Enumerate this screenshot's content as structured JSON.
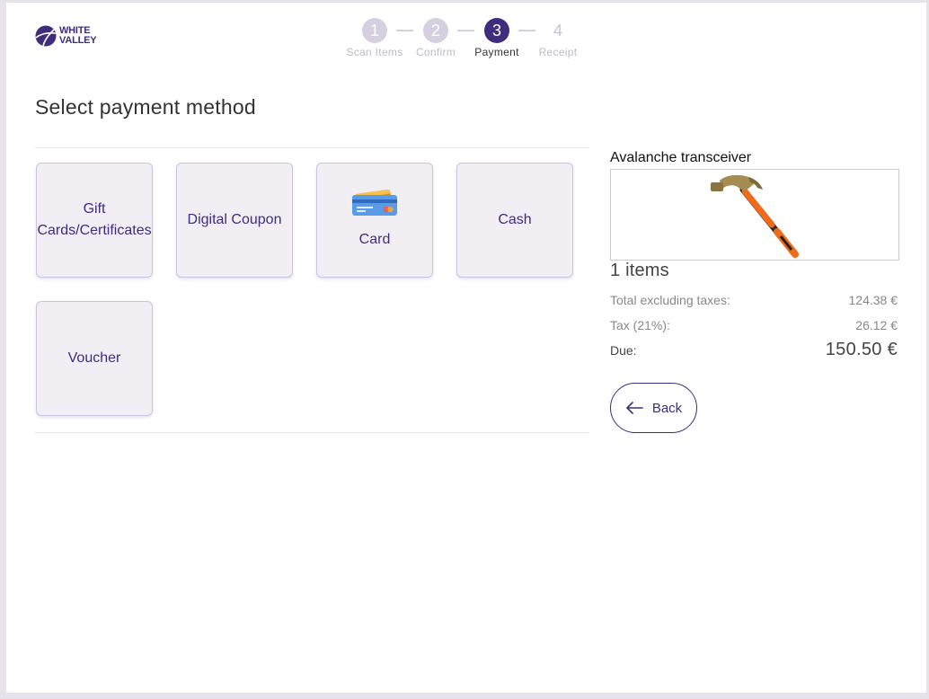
{
  "brand": {
    "logo_line1": "WHITE",
    "logo_line2": "VALLEY",
    "accent_color": "#3f2c7d"
  },
  "stepper": {
    "steps": [
      {
        "number": "1",
        "label": "Scan Items",
        "state": "done"
      },
      {
        "number": "2",
        "label": "Confirm",
        "state": "done"
      },
      {
        "number": "3",
        "label": "Payment",
        "state": "active"
      },
      {
        "number": "4",
        "label": "Receipt",
        "state": "pending"
      }
    ]
  },
  "main": {
    "title": "Select payment method",
    "methods": [
      {
        "label": "Gift Cards/Certificates"
      },
      {
        "label": "Digital Coupon"
      },
      {
        "label": "Card",
        "icon": "credit-card-icon"
      },
      {
        "label": "Cash"
      },
      {
        "label": "Voucher"
      }
    ]
  },
  "summary": {
    "product_name": "Avalanche transceiver",
    "product_image_icon": "hammer-icon",
    "items_count": "1 items",
    "total_excl_label": "Total excluding taxes:",
    "total_excl_value": "124.38 €",
    "tax_label": "Tax (21%):",
    "tax_value": "26.12 €",
    "due_label": "Due:",
    "due_value": "150.50 €"
  },
  "actions": {
    "back_label": "Back",
    "back_icon": "arrow-left-icon"
  }
}
